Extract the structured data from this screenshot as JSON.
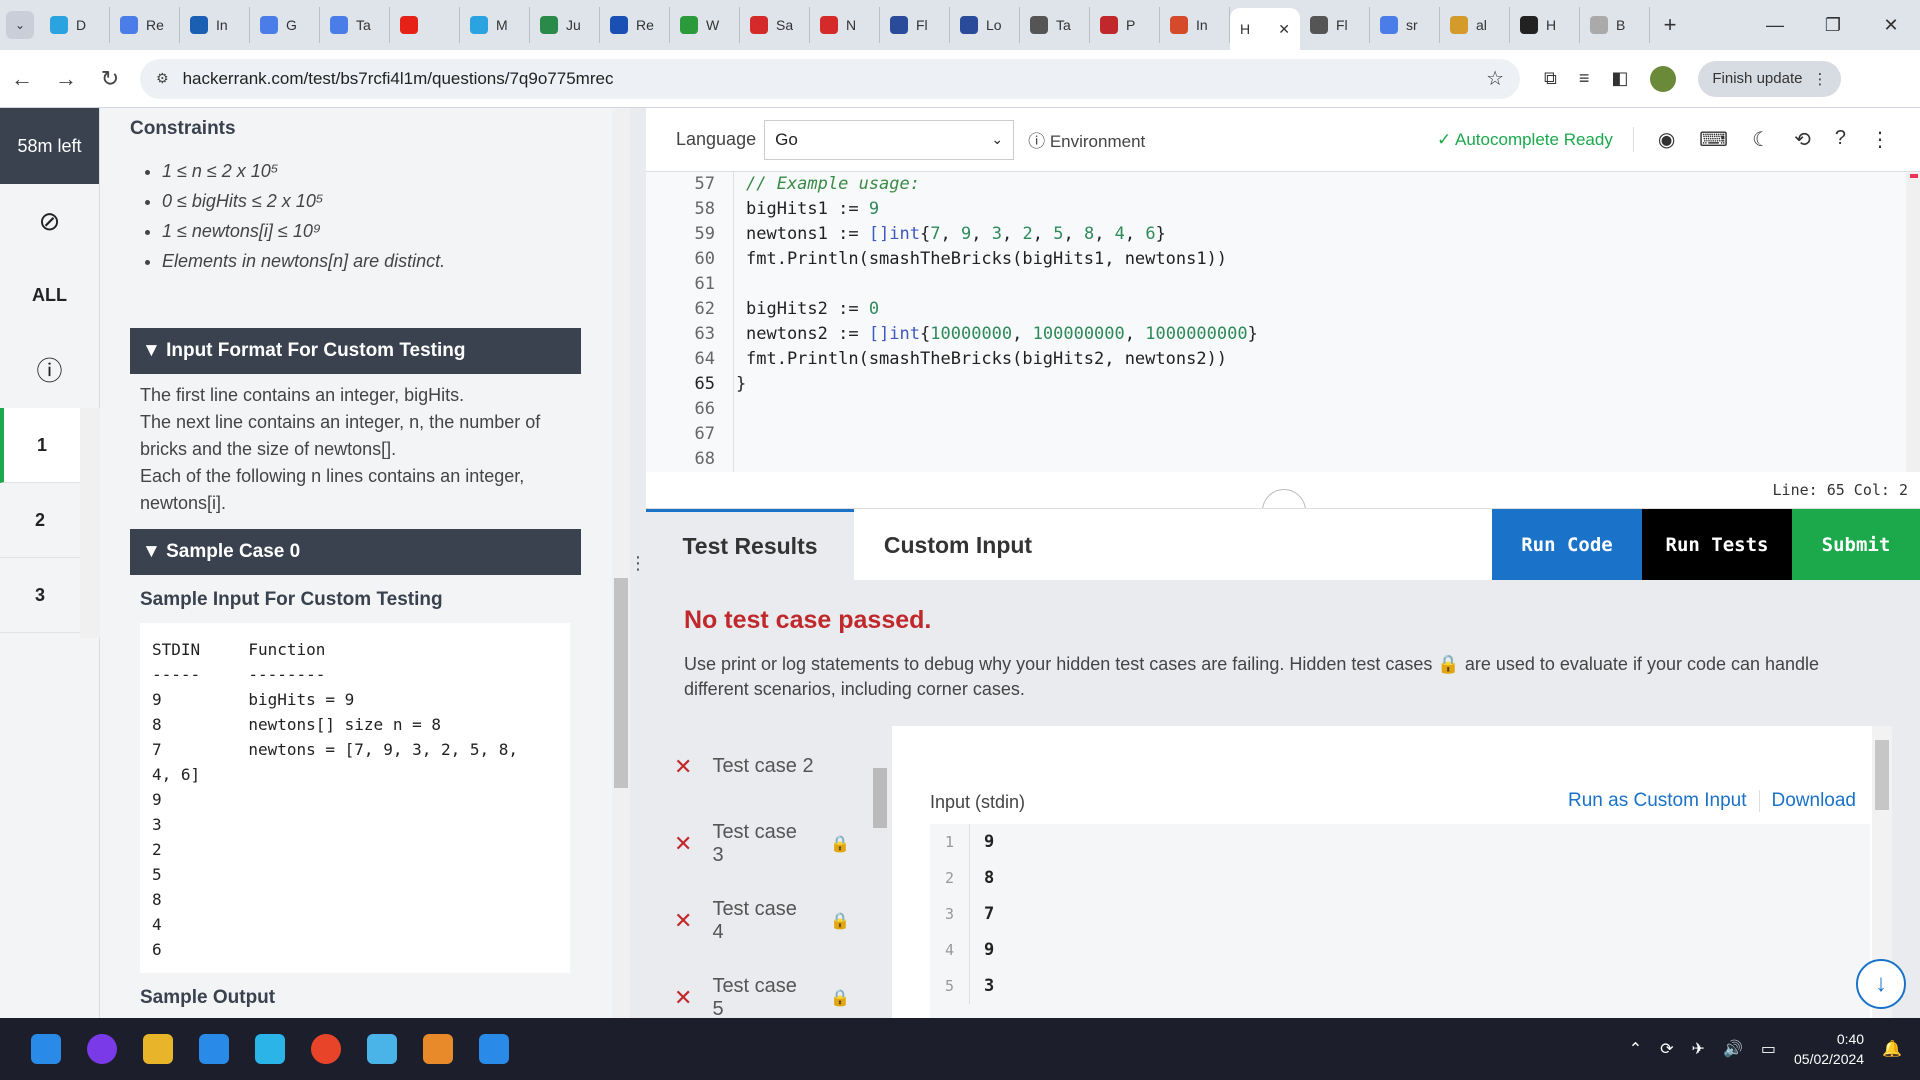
{
  "browser": {
    "tabs": [
      {
        "label": "D",
        "color": "#2aa3e0"
      },
      {
        "label": "Re",
        "color": "#4a7de8"
      },
      {
        "label": "In",
        "color": "#1a5fb4"
      },
      {
        "label": "G",
        "color": "#4a7de8"
      },
      {
        "label": "Ta",
        "color": "#4a7de8"
      },
      {
        "label": "",
        "color": "#e62117"
      },
      {
        "label": "M",
        "color": "#2aa3e0"
      },
      {
        "label": "Ju",
        "color": "#2a8a4a"
      },
      {
        "label": "Re",
        "color": "#1a4fb4"
      },
      {
        "label": "W",
        "color": "#2a9a3a"
      },
      {
        "label": "Sa",
        "color": "#d42a2a"
      },
      {
        "label": "N",
        "color": "#d42a2a"
      },
      {
        "label": "Fl",
        "color": "#2a4a9a"
      },
      {
        "label": "Lo",
        "color": "#2a4a9a"
      },
      {
        "label": "Ta",
        "color": "#555555"
      },
      {
        "label": "P",
        "color": "#c0282c"
      },
      {
        "label": "In",
        "color": "#d44a2a"
      }
    ],
    "active_tab": {
      "label": "H",
      "close": "✕"
    },
    "tabs_after": [
      {
        "label": "Fl",
        "color": "#555555"
      },
      {
        "label": "sr",
        "color": "#4a7de8"
      },
      {
        "label": "al",
        "color": "#d49a2a"
      },
      {
        "label": "H",
        "color": "#222222"
      },
      {
        "label": "B",
        "color": "#aaaaaa"
      }
    ],
    "url": "hackerrank.com/test/bs7rcfi4l1m/questions/7q9o775mrec",
    "finish_update": "Finish update"
  },
  "rail": {
    "time_left": "58m left",
    "all_label": "ALL",
    "questions": [
      "1",
      "2",
      "3"
    ]
  },
  "problem": {
    "constraints_title": "Constraints",
    "constraints": [
      "1 ≤ n ≤ 2 x 10⁵",
      "0 ≤ bigHits ≤ 2 x 10⁵",
      "1 ≤ newtons[i] ≤ 10⁹",
      "Elements in newtons[n] are distinct."
    ],
    "input_format_title": "▼ Input Format For Custom Testing",
    "input_format_lines": [
      "The first line contains an integer, bigHits.",
      "The next line contains an integer, n, the number of bricks and the size of newtons[].",
      "Each of the following n lines contains an integer, newtons[i]."
    ],
    "sample_case_title": "▼ Sample Case 0",
    "sample_input_title": "Sample Input For Custom Testing",
    "sample_input": "STDIN     Function\n-----     --------\n9         bigHits = 9\n8         newtons[] size n = 8\n7         newtons = [7, 9, 3, 2, 5, 8,\n4, 6]\n9\n3\n2\n5\n8\n4\n6",
    "sample_output_title": "Sample Output"
  },
  "editor": {
    "language_label": "Language",
    "language": "Go",
    "environment": "Environment",
    "autocomplete": "Autocomplete Ready",
    "line_numbers": [
      "57",
      "58",
      "59",
      "60",
      "61",
      "62",
      "63",
      "64",
      "65",
      "66",
      "67",
      "68"
    ],
    "active_line": "65",
    "status": "Line: 65 Col: 2"
  },
  "results": {
    "tabs": [
      "Test Results",
      "Custom Input"
    ],
    "run_code": "Run Code",
    "run_tests": "Run Tests",
    "submit": "Submit",
    "summary": "No test case passed.",
    "hint": "Use print or log statements to debug why your hidden test cases are failing. Hidden test cases 🔒 are used to evaluate if your code can handle different scenarios, including corner cases.",
    "cases": [
      {
        "label": "Test case 2",
        "locked": false
      },
      {
        "label": "Test case 3",
        "locked": true
      },
      {
        "label": "Test case 4",
        "locked": true
      },
      {
        "label": "Test case 5",
        "locked": true
      }
    ],
    "input_label": "Input (stdin)",
    "run_as_custom": "Run as Custom Input",
    "download": "Download",
    "input_lines": [
      {
        "n": "1",
        "v": "9"
      },
      {
        "n": "2",
        "v": "8"
      },
      {
        "n": "3",
        "v": "7"
      },
      {
        "n": "4",
        "v": "9"
      },
      {
        "n": "5",
        "v": "3"
      }
    ]
  },
  "taskbar": {
    "time": "0:40",
    "date": "05/02/2024"
  }
}
